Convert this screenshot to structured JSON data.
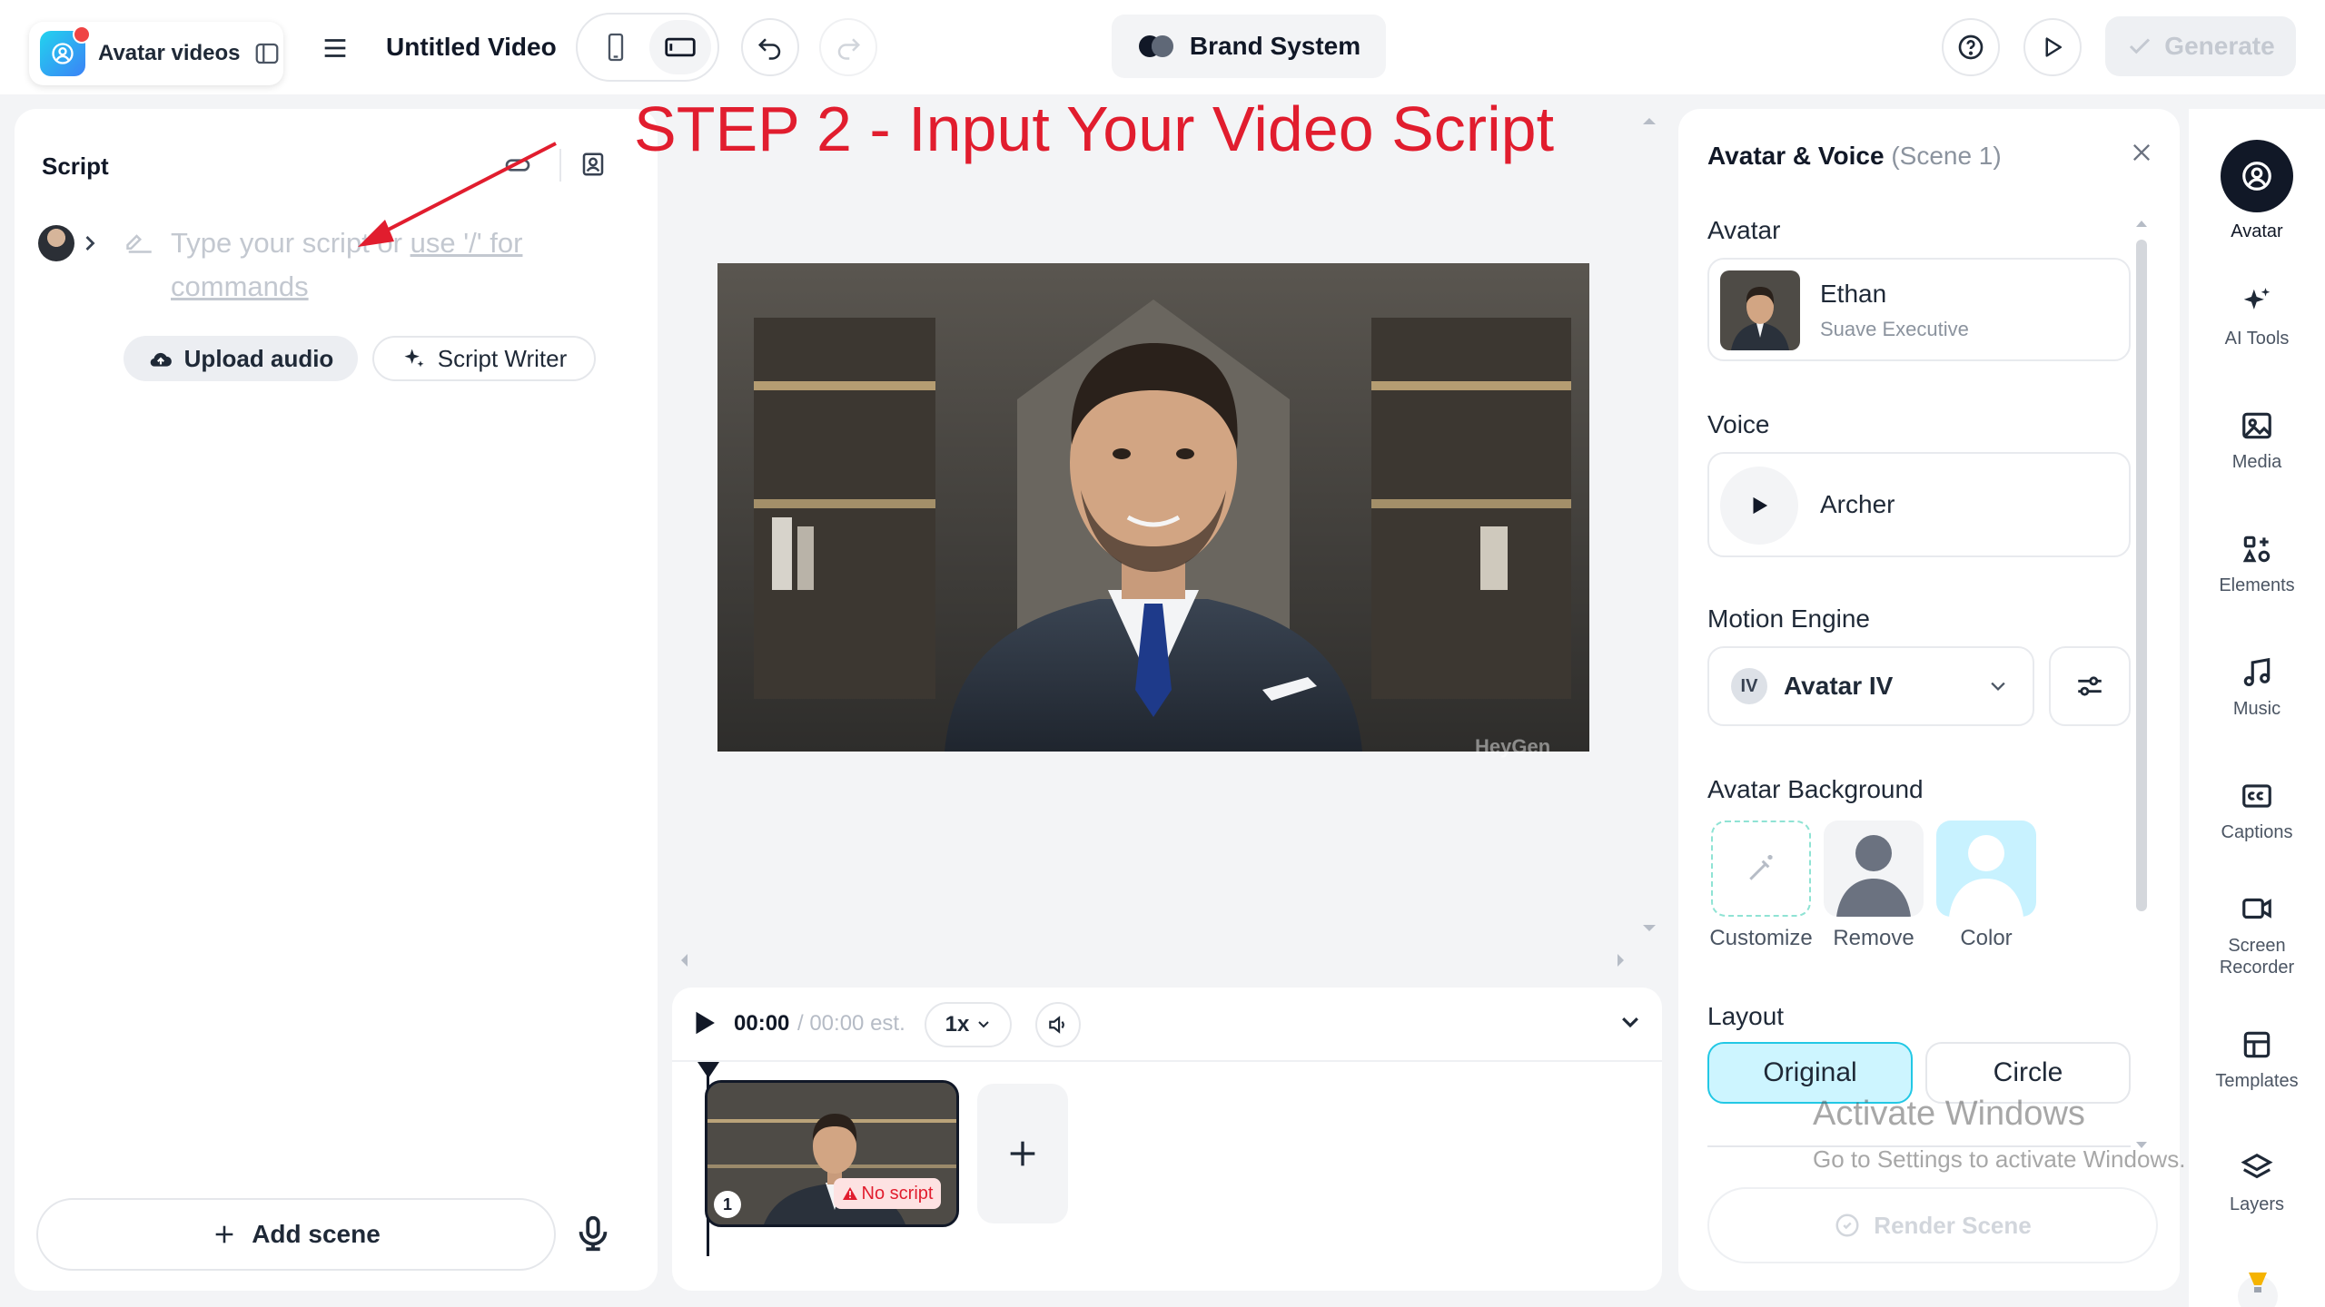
{
  "header": {
    "app_name": "Avatar videos",
    "video_title": "Untitled Video",
    "brand_label": "Brand System",
    "generate_label": "Generate"
  },
  "annotation": "STEP 2 - Input Your Video Script",
  "script_panel": {
    "title": "Script",
    "placeholder_text": "Type your script or ",
    "placeholder_link": "use '/' for commands",
    "upload_audio": "Upload audio",
    "script_writer": "Script Writer",
    "add_scene": "Add scene"
  },
  "canvas": {
    "watermark": "HeyGen"
  },
  "timeline": {
    "current_time": "00:00",
    "estimate": "/ 00:00 est.",
    "speed": "1x",
    "scene_number": "1",
    "no_script": "No script"
  },
  "properties": {
    "title": "Avatar & Voice",
    "scene": "(Scene 1)",
    "avatar_label": "Avatar",
    "avatar_name": "Ethan",
    "avatar_style": "Suave Executive",
    "voice_label": "Voice",
    "voice_name": "Archer",
    "motion_label": "Motion Engine",
    "motion_badge": "IV",
    "motion_value": "Avatar IV",
    "background_label": "Avatar Background",
    "bg_options": [
      "Customize",
      "Remove",
      "Color"
    ],
    "layout_label": "Layout",
    "layout_options": [
      "Original",
      "Circle"
    ],
    "render_label": "Render Scene"
  },
  "windows_notice": {
    "title": "Activate Windows",
    "subtitle": "Go to Settings to activate Windows."
  },
  "rail": {
    "items": [
      "Avatar",
      "AI Tools",
      "Media",
      "Elements",
      "Music",
      "Captions",
      "Screen Recorder",
      "Templates",
      "Layers"
    ]
  },
  "colors": {
    "annotation": "#e11d2e",
    "accent": "#22c8e5",
    "active_rail": "#111827"
  }
}
